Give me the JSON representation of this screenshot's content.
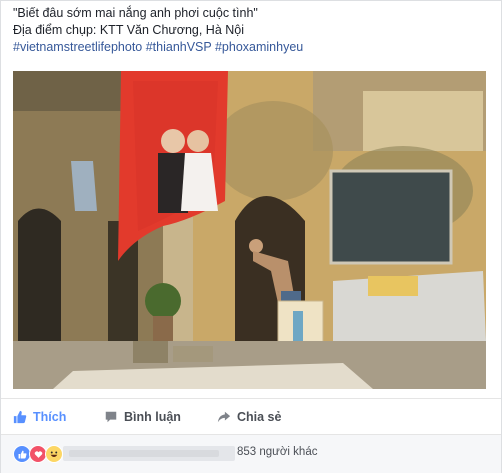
{
  "post": {
    "caption": "\"Biết đâu sớm mai nắng anh phơi cuộc tình\"",
    "location": "Địa điểm chụp: KTT Văn Chương, Hà Nội",
    "hashtags": "#vietnamstreetlifephoto #thianhVSP #phoxaminhyeu"
  },
  "actions": {
    "like_label": "Thích",
    "comment_label": "Bình luận",
    "share_label": "Chia sẻ"
  },
  "reactions": {
    "types": [
      "like",
      "love",
      "haha"
    ],
    "others_count": "853",
    "others_text": "người khác"
  },
  "colors": {
    "like_blue": "#5890ff",
    "link_blue": "#365899",
    "love_red": "#f25268",
    "haha_yellow": "#fcd664"
  },
  "icons": {
    "like": "thumbs-up-icon",
    "comment": "comment-bubble-icon",
    "share": "share-arrow-icon"
  }
}
